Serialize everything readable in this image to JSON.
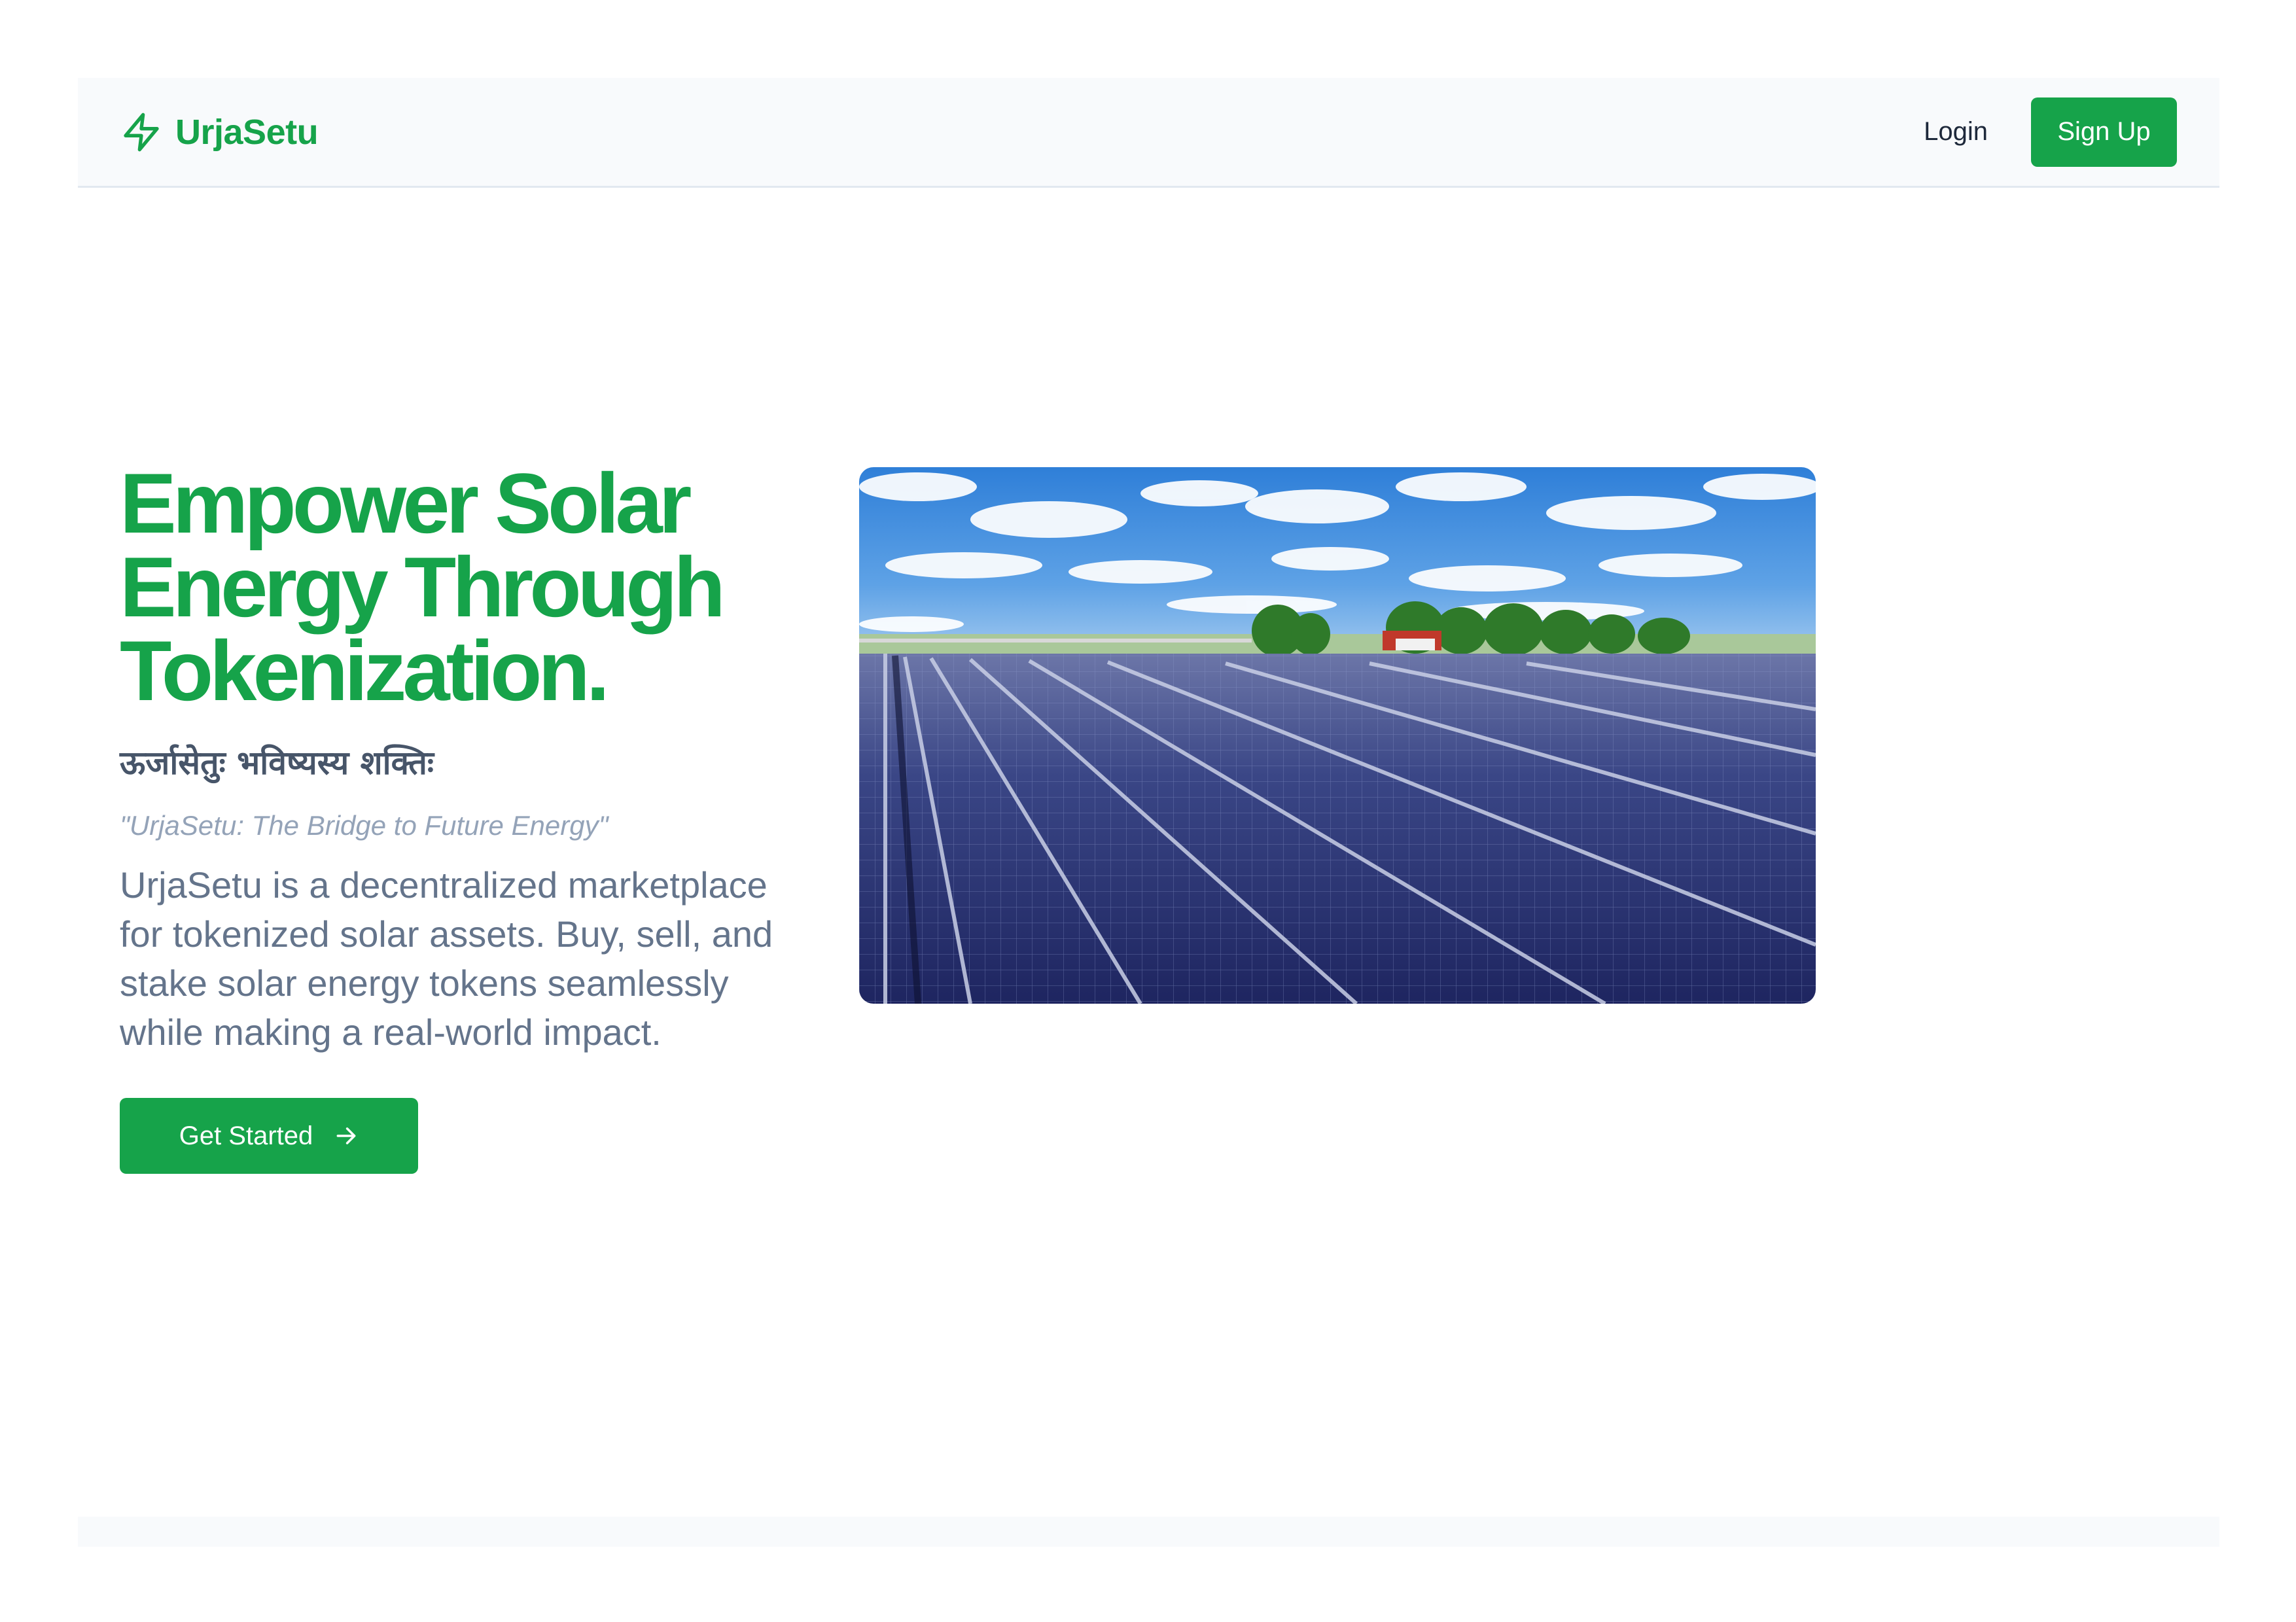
{
  "header": {
    "brand_name": "UrjaSetu",
    "brand_icon": "lightning-bolt-icon",
    "login_label": "Login",
    "signup_label": "Sign Up"
  },
  "hero": {
    "headline": "Empower Solar Energy Through Tokenization.",
    "sanskrit_tagline": "ऊर्जासेतुः भविष्यस्य शक्तिः",
    "translation": "\"UrjaSetu: The Bridge to Future Energy\"",
    "description": "UrjaSetu is a decentralized marketplace for tokenized solar assets. Buy, sell, and stake solar energy tokens seamlessly while making a real-world impact.",
    "cta_label": "Get Started",
    "cta_icon": "arrow-right-icon",
    "image": "solar-farm-photo"
  },
  "colors": {
    "brand_green": "#16a34a",
    "heading_slate": "#475569",
    "body_slate": "#64748b",
    "muted_slate": "#94a3b8",
    "nav_background": "#f8fafc"
  }
}
